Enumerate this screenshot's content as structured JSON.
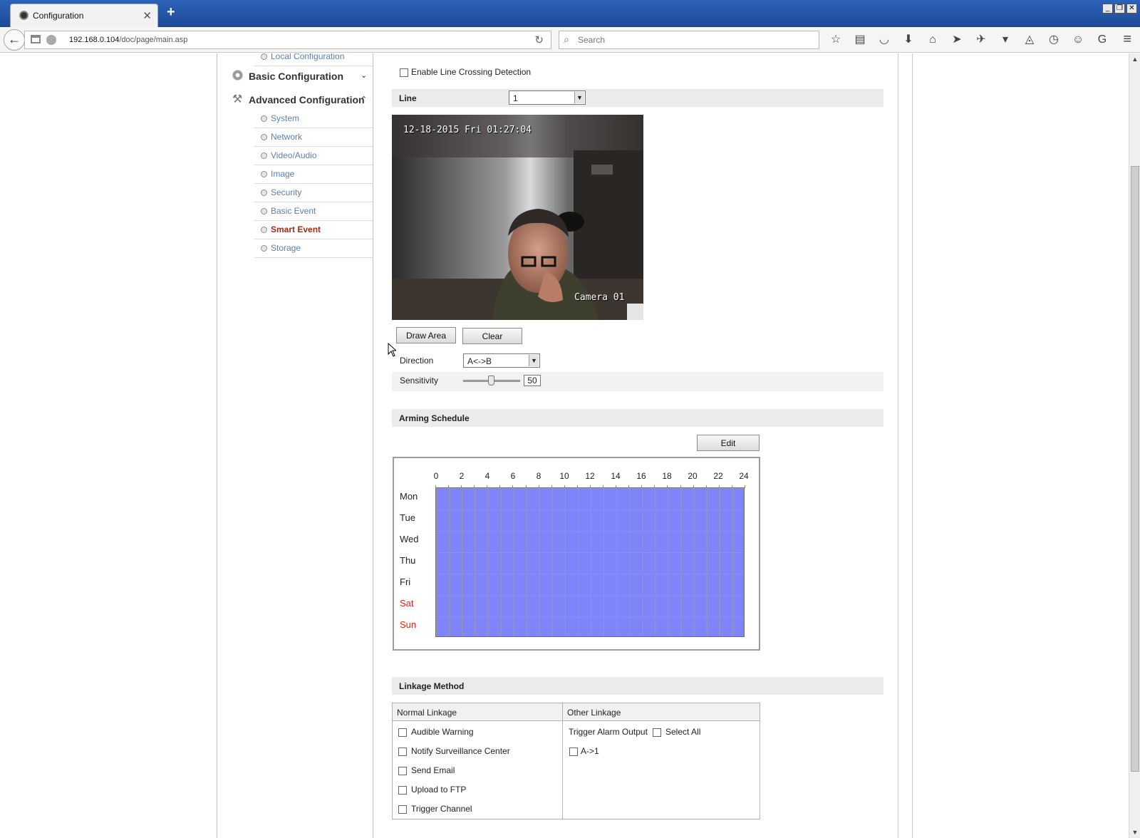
{
  "browser": {
    "tab_title": "Configuration",
    "tab_close": "✕",
    "new_tab": "+",
    "url_host": "192.168.0.104",
    "url_path": "/doc/page/main.asp",
    "search_placeholder": "Search"
  },
  "sidebar": {
    "local_configuration": "Local Configuration",
    "basic_configuration": "Basic Configuration",
    "advanced_configuration": "Advanced Configuration",
    "items": [
      {
        "label": "System"
      },
      {
        "label": "Network"
      },
      {
        "label": "Video/Audio"
      },
      {
        "label": "Image"
      },
      {
        "label": "Security"
      },
      {
        "label": "Basic Event"
      },
      {
        "label": "Smart Event",
        "active": true
      },
      {
        "label": "Storage"
      }
    ]
  },
  "line_crossing": {
    "enable_label": "Enable Line Crossing Detection",
    "enabled": false,
    "line_label": "Line",
    "line_value": "1",
    "video_timestamp": "12-18-2015 Fri 01:27:04",
    "video_camera_name": "Camera 01",
    "draw_area_label": "Draw Area",
    "clear_label": "Clear",
    "direction_label": "Direction",
    "direction_value": "A<->B",
    "sensitivity_label": "Sensitivity",
    "sensitivity_value": "50"
  },
  "arming_schedule": {
    "title": "Arming Schedule",
    "edit_label": "Edit",
    "hours": [
      "0",
      "2",
      "4",
      "6",
      "8",
      "10",
      "12",
      "14",
      "16",
      "18",
      "20",
      "22",
      "24"
    ],
    "days": [
      "Mon",
      "Tue",
      "Wed",
      "Thu",
      "Fri",
      "Sat",
      "Sun"
    ],
    "weekend_color": "#e1251b",
    "armed_color": "#7f84fb"
  },
  "linkage": {
    "title": "Linkage Method",
    "normal_header": "Normal Linkage",
    "other_header": "Other Linkage",
    "normal_items": [
      {
        "label": "Audible Warning",
        "checked": false
      },
      {
        "label": "Notify Surveillance Center",
        "checked": false
      },
      {
        "label": "Send Email",
        "checked": false
      },
      {
        "label": "Upload to FTP",
        "checked": false
      },
      {
        "label": "Trigger Channel",
        "checked": false
      }
    ],
    "trigger_alarm_output": "Trigger Alarm Output",
    "select_all": "Select All",
    "alarm_outputs": [
      {
        "label": "A->1",
        "checked": false
      }
    ]
  }
}
